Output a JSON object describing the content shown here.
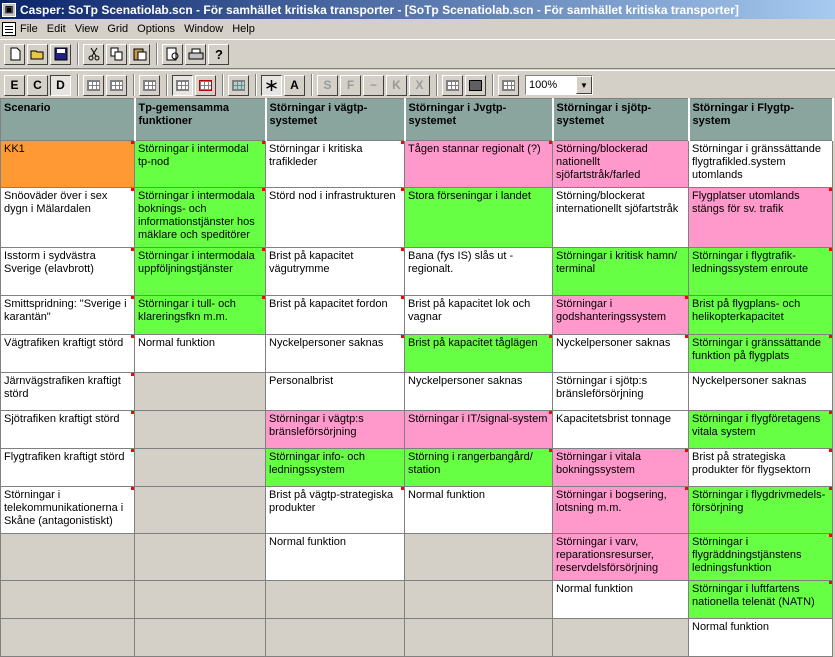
{
  "window": {
    "title": "Casper: SoTp Scenatiolab.scn - För samhället kritiska transporter - [SoTp Scenatiolab.scn - För samhället kritiska transporter]"
  },
  "menu": [
    "File",
    "Edit",
    "View",
    "Grid",
    "Options",
    "Window",
    "Help"
  ],
  "toolbar2": {
    "e_label": "E",
    "c_label": "C",
    "d_label": "D",
    "a_label": "A",
    "s_label": "S",
    "f_label": "F",
    "minus_label": "−",
    "k_label": "K",
    "x_label": "X",
    "zoom": "100%"
  },
  "colors": {
    "orange": "#ff9933",
    "green": "#66ff44",
    "pink": "#ff99cc",
    "header": "#8aa59e"
  },
  "headers": [
    "Scenario",
    "Tp-gemensamma funktioner",
    "Störningar i vägtp-systemet",
    "Störningar i Jvgtp-systemet",
    "Störningar i sjötp-systemet",
    "Störningar i Flygtp-system"
  ],
  "rows": [
    [
      {
        "t": "KK1",
        "c": "orange",
        "m": true
      },
      {
        "t": "Störningar i intermodal tp-nod",
        "c": "green",
        "m": true
      },
      {
        "t": "Störningar i kritiska trafikleder",
        "c": "white",
        "m": true
      },
      {
        "t": "Tågen stannar regionalt (?)",
        "c": "pink",
        "m": true
      },
      {
        "t": "Störning/blockerad nationellt sjöfartstråk/farled",
        "c": "pink",
        "m": false
      },
      {
        "t": "Störningar i gränssättande flygtrafikled.system utomlands",
        "c": "white",
        "m": false
      }
    ],
    [
      {
        "t": "Snöoväder över i sex dygn i Mälardalen",
        "c": "white",
        "m": true
      },
      {
        "t": "Störningar i intermodala boknings- och informationstjänster hos mäklare och speditörer",
        "c": "green",
        "m": true
      },
      {
        "t": "Störd nod i infrastrukturen",
        "c": "white",
        "m": true
      },
      {
        "t": "Stora förseningar i landet",
        "c": "green",
        "m": false
      },
      {
        "t": "Störning/blockerat internationellt sjöfartstråk",
        "c": "white",
        "m": false
      },
      {
        "t": "Flygplatser utomlands stängs för sv. trafik",
        "c": "pink",
        "m": true
      }
    ],
    [
      {
        "t": "Isstorm i sydvästra Sverige (elavbrott)",
        "c": "white",
        "m": true
      },
      {
        "t": "Störningar i intermodala uppföljningstjänster",
        "c": "green",
        "m": true
      },
      {
        "t": "Brist på kapacitet vägutrymme",
        "c": "white",
        "m": true
      },
      {
        "t": "Bana (fys IS) slås ut - regionalt.",
        "c": "white",
        "m": false
      },
      {
        "t": "Störningar i kritisk hamn/ terminal",
        "c": "green",
        "m": false
      },
      {
        "t": "Störningar i flygtrafik-ledningssystem enroute",
        "c": "green",
        "m": true
      }
    ],
    [
      {
        "t": "Smittspridning: \"Sverige i karantän\"",
        "c": "white",
        "m": true
      },
      {
        "t": "Störningar i tull- och klareringsfkn m.m.",
        "c": "green",
        "m": true
      },
      {
        "t": "Brist på kapacitet fordon",
        "c": "white",
        "m": true
      },
      {
        "t": "Brist på kapacitet lok och vagnar",
        "c": "white",
        "m": false
      },
      {
        "t": "Störningar i godshanteringssystem",
        "c": "pink",
        "m": true
      },
      {
        "t": "Brist på flygplans- och helikopterkapacitet",
        "c": "green",
        "m": false
      }
    ],
    [
      {
        "t": "Vägtrafiken kraftigt störd",
        "c": "white",
        "m": true
      },
      {
        "t": "Normal funktion",
        "c": "white",
        "m": false
      },
      {
        "t": "Nyckelpersoner saknas",
        "c": "white",
        "m": true
      },
      {
        "t": "Brist på kapacitet tåglägen",
        "c": "green",
        "m": true
      },
      {
        "t": "Nyckelpersoner saknas",
        "c": "white",
        "m": true
      },
      {
        "t": "Störningar i gränssättande funktion på flygplats",
        "c": "green",
        "m": true
      }
    ],
    [
      {
        "t": "Järnvägstrafiken kraftigt störd",
        "c": "white",
        "m": true
      },
      {
        "t": "",
        "c": "gray",
        "m": false
      },
      {
        "t": "Personalbrist",
        "c": "white",
        "m": false
      },
      {
        "t": "Nyckelpersoner saknas",
        "c": "white",
        "m": false
      },
      {
        "t": "Störningar i sjötp:s bränsleförsörjning",
        "c": "white",
        "m": false
      },
      {
        "t": "Nyckelpersoner saknas",
        "c": "white",
        "m": false
      }
    ],
    [
      {
        "t": "Sjötrafiken kraftigt störd",
        "c": "white",
        "m": true
      },
      {
        "t": "",
        "c": "gray",
        "m": false
      },
      {
        "t": "Störningar i vägtp:s bränsleförsörjning",
        "c": "pink",
        "m": false
      },
      {
        "t": "Störningar i IT/signal-system",
        "c": "pink",
        "m": true
      },
      {
        "t": "Kapacitetsbrist tonnage",
        "c": "white",
        "m": false
      },
      {
        "t": "Störningar i flygföretagens vitala system",
        "c": "green",
        "m": true
      }
    ],
    [
      {
        "t": "Flygtrafiken kraftigt störd",
        "c": "white",
        "m": true
      },
      {
        "t": "",
        "c": "gray",
        "m": false
      },
      {
        "t": "Störningar info- och ledningssystem",
        "c": "green",
        "m": false
      },
      {
        "t": "Störning i rangerbangård/ station",
        "c": "green",
        "m": true
      },
      {
        "t": "Störningar i vitala bokningssystem",
        "c": "pink",
        "m": true
      },
      {
        "t": "Brist på strategiska produkter för flygsektorn",
        "c": "white",
        "m": true
      }
    ],
    [
      {
        "t": "Störningar i telekommunikationerna i Skåne (antagonistiskt)",
        "c": "white",
        "m": true
      },
      {
        "t": "",
        "c": "gray",
        "m": false
      },
      {
        "t": "Brist på vägtp-strategiska produkter",
        "c": "white",
        "m": true
      },
      {
        "t": "Normal funktion",
        "c": "white",
        "m": false
      },
      {
        "t": "Störningar i bogsering, lotsning m.m.",
        "c": "pink",
        "m": true
      },
      {
        "t": "Störningar i flygdrivmedels-försörjning",
        "c": "green",
        "m": true
      }
    ],
    [
      {
        "t": "",
        "c": "gray",
        "m": false
      },
      {
        "t": "",
        "c": "gray",
        "m": false
      },
      {
        "t": "Normal funktion",
        "c": "white",
        "m": false
      },
      {
        "t": "",
        "c": "gray",
        "m": false
      },
      {
        "t": "Störningar i varv, reparationsresurser, reservdelsförsörjning",
        "c": "pink",
        "m": false
      },
      {
        "t": "Störningar i flygräddningstjänstens ledningsfunktion",
        "c": "green",
        "m": true
      }
    ],
    [
      {
        "t": "",
        "c": "gray",
        "m": false
      },
      {
        "t": "",
        "c": "gray",
        "m": false
      },
      {
        "t": "",
        "c": "gray",
        "m": false
      },
      {
        "t": "",
        "c": "gray",
        "m": false
      },
      {
        "t": "Normal funktion",
        "c": "white",
        "m": false
      },
      {
        "t": "Störningar i luftfartens nationella telenät (NATN)",
        "c": "green",
        "m": true
      }
    ],
    [
      {
        "t": "",
        "c": "gray",
        "m": false
      },
      {
        "t": "",
        "c": "gray",
        "m": false
      },
      {
        "t": "",
        "c": "gray",
        "m": false
      },
      {
        "t": "",
        "c": "gray",
        "m": false
      },
      {
        "t": "",
        "c": "gray",
        "m": false
      },
      {
        "t": "Normal funktion",
        "c": "white",
        "m": false
      }
    ]
  ]
}
